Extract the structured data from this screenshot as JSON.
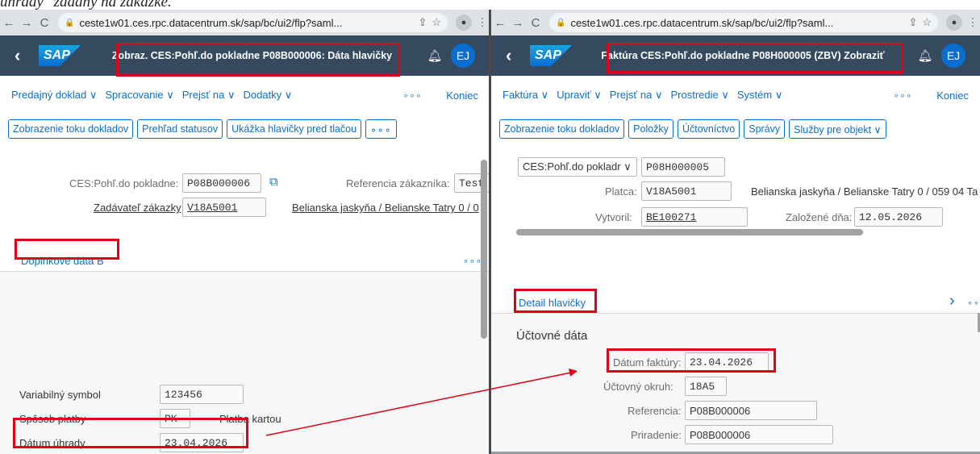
{
  "doc_caption": "úhrady\" zadaný na zákazke.",
  "browser": {
    "back": "←",
    "forward": "→",
    "reload": "C",
    "share": "⇪",
    "star": "☆",
    "kebab": "⋮",
    "lock": "🔒"
  },
  "left": {
    "url": "ceste1w01.ces.rpc.datacentrum.sk/sap/bc/ui2/flp?saml...",
    "shell_title": "Zobraz. CES:Pohľ.do pokladne P08B000006: Dáta hlavičky",
    "avatar": "EJ",
    "menu": [
      "Predajný doklad ∨",
      "Spracovanie ∨",
      "Prejsť na ∨",
      "Dodatky ∨"
    ],
    "menu_more": "∘∘∘",
    "menu_end": "Koniec",
    "buttons": [
      "Zobrazenie toku dokladov",
      "Prehľad statusov",
      "Ukážka hlavičky pred tlačou"
    ],
    "button_more": "∘∘∘",
    "f1_label": "CES:Pohľ.do pokladne:",
    "f1_value": "P08B000006",
    "ref_label": "Referencia zákazníka:",
    "ref_value": "Test",
    "zad_label": "Zadávateľ zákazky",
    "zad_value": "V18A5001",
    "addr": "Belianska jaskyňa / Belianske Tatry 0 / 0",
    "tab": "Doplnkové dáta B",
    "tab_more": "∘∘∘",
    "var_label": "Variabilný symbol",
    "var_value": "123456",
    "pay_label": "Spôsob platby",
    "pay_value": "PK",
    "pay_text": "Platba kartou",
    "due_label": "Dátum úhrady",
    "due_value": "23.04.2026"
  },
  "right": {
    "url": "ceste1w01.ces.rpc.datacentrum.sk/sap/bc/ui2/flp?saml...",
    "shell_title": "Faktúra CES:Pohľ.do pokladne P08H000005 (ZBV) Zobraziť",
    "avatar": "EJ",
    "menu": [
      "Faktúra ∨",
      "Upraviť ∨",
      "Prejsť na ∨",
      "Prostredie ∨",
      "Systém ∨"
    ],
    "menu_more": "∘∘∘",
    "menu_end": "Koniec",
    "buttons": [
      "Zobrazenie toku dokladov",
      "Položky",
      "Účtovníctvo",
      "Správy",
      "Služby pre objekt ∨"
    ],
    "doc_select": "CES:Pohľ.do pokladr ∨",
    "doc_value": "P08H000005",
    "platca_label": "Platca:",
    "platca_value": "V18A5001",
    "addr": "Belianska jaskyňa / Belianske Tatry 0 / 059 04 Ta",
    "vyt_label": "Vytvoril:",
    "vyt_value": "BE100271",
    "zal_label": "Založené dňa:",
    "zal_value": "12.05.2026",
    "tab": "Detail hlavičky",
    "tab_arrow": "›",
    "tab_more": "∘∘",
    "section": "Účtovné dáta",
    "df_label": "Dátum faktúry:",
    "df_value": "23.04.2026",
    "uo_label": "Účtovný okruh:",
    "uo_value": "18A5",
    "refr_label": "Referencia:",
    "refr_value": "P08B000006",
    "pri_label": "Priradenie:",
    "pri_value": "P08B000006"
  },
  "colors": {
    "shell": "#354a5f",
    "accent": "#0a6ed1",
    "highlight": "#e0001a"
  }
}
